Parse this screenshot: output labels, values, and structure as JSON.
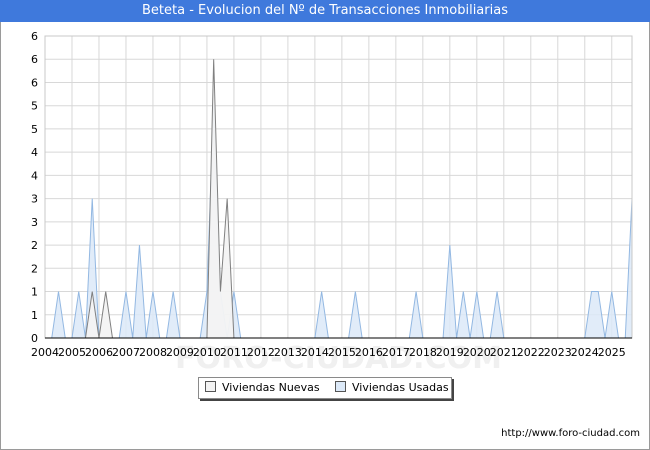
{
  "title": "Beteta - Evolucion del Nº de Transacciones Inmobiliarias",
  "footer_url": "http://www.foro-ciudad.com",
  "watermark": "FORO-CIUDAD.COM",
  "colors": {
    "title_bg": "#3f79dc",
    "nuevas_fill": "#f3f3f3",
    "nuevas_line": "#808080",
    "usadas_fill": "#dce9f8",
    "usadas_line": "#93b8e2",
    "grid": "#d8d8d8"
  },
  "chart_data": {
    "type": "area",
    "xlabel": "",
    "ylabel": "",
    "ylim": [
      0,
      6.5
    ],
    "y_tick_labels": [
      "0",
      "1",
      "1",
      "2",
      "2",
      "3",
      "3",
      "4",
      "4",
      "5",
      "5",
      "6",
      "6",
      "6"
    ],
    "x_tick_labels": [
      "2004",
      "2005",
      "2006",
      "2007",
      "2008",
      "2009",
      "2010",
      "2011",
      "2012",
      "2013",
      "2014",
      "2015",
      "2016",
      "2017",
      "2018",
      "2019",
      "2020",
      "2021",
      "2022",
      "2023",
      "2024",
      "2025"
    ],
    "x_start": 2004,
    "x_end": 2025.75,
    "x_step": 0.25,
    "grid": true,
    "legend_position": "bottom-center",
    "series": [
      {
        "name": "Viviendas Nuevas",
        "values": [
          0,
          0,
          0,
          0,
          0,
          0,
          0,
          1,
          0,
          1,
          0,
          0,
          0,
          0,
          0,
          0,
          0,
          0,
          0,
          0,
          0,
          0,
          0,
          0,
          0,
          6,
          1,
          3,
          0,
          0,
          0,
          0,
          0,
          0,
          0,
          0,
          0,
          0,
          0,
          0,
          0,
          0,
          0,
          0,
          0,
          0,
          0,
          0,
          0,
          0,
          0,
          0,
          0,
          0,
          0,
          0,
          0,
          0,
          0,
          0,
          0,
          0,
          0,
          0,
          0,
          0,
          0,
          0,
          0,
          0,
          0,
          0,
          0,
          0,
          0,
          0,
          0,
          0,
          0,
          0,
          0,
          0,
          0,
          0,
          0,
          0,
          0,
          0
        ]
      },
      {
        "name": "Viviendas Usadas",
        "values": [
          0,
          0,
          1,
          0,
          0,
          1,
          0,
          3,
          0,
          0,
          0,
          0,
          1,
          0,
          2,
          0,
          1,
          0,
          0,
          1,
          0,
          0,
          0,
          0,
          1,
          5,
          1,
          0,
          1,
          0,
          0,
          0,
          0,
          0,
          0,
          0,
          0,
          0,
          0,
          0,
          0,
          1,
          0,
          0,
          0,
          0,
          1,
          0,
          0,
          0,
          0,
          0,
          0,
          0,
          0,
          1,
          0,
          0,
          0,
          0,
          2,
          0,
          1,
          0,
          1,
          0,
          0,
          1,
          0,
          0,
          0,
          0,
          0,
          0,
          0,
          0,
          0,
          0,
          0,
          0,
          0,
          1,
          1,
          0,
          1,
          0,
          0,
          3
        ]
      }
    ]
  },
  "legend": {
    "nuevas_label": "Viviendas Nuevas",
    "usadas_label": "Viviendas Usadas"
  }
}
